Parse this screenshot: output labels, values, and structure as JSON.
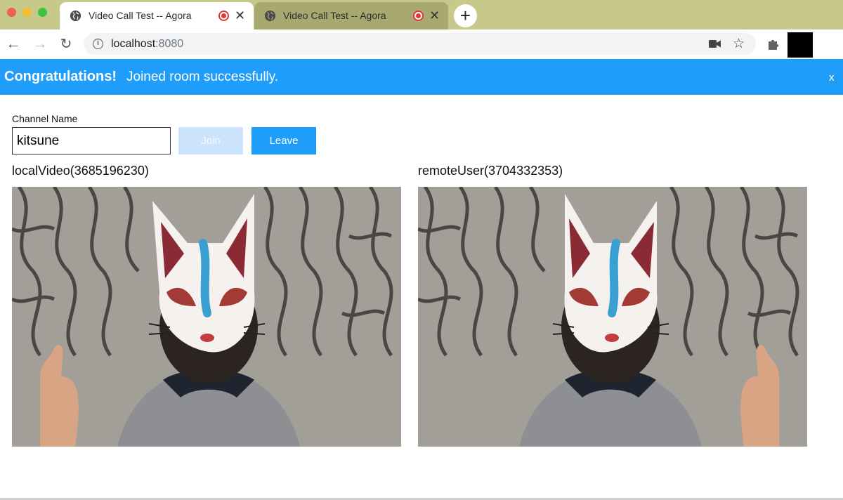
{
  "browser": {
    "tabs": [
      {
        "title": "Video Call Test -- Agora",
        "active": true
      },
      {
        "title": "Video Call Test -- Agora",
        "active": false
      }
    ],
    "address": {
      "host": "localhost",
      "port": ":8080"
    },
    "icons": {
      "back": "arrow-left-icon",
      "forward": "arrow-right-icon",
      "reload": "reload-icon",
      "info": "info-icon",
      "camera": "video-camera-icon",
      "bookmark": "star-icon",
      "extensions": "puzzle-icon",
      "tab_favicon": "globe-icon",
      "recording": "recording-icon",
      "close": "close-icon",
      "new_tab": "plus-icon"
    }
  },
  "banner": {
    "strong": "Congratulations!",
    "message": "Joined room successfully.",
    "close": "x",
    "color": "#1e9dfb"
  },
  "form": {
    "channel_label": "Channel Name",
    "channel_value": "kitsune",
    "join_label": "Join",
    "leave_label": "Leave"
  },
  "videos": {
    "local_label": "localVideo(3685196230)",
    "remote_label": "remoteUser(3704332353)"
  },
  "colors": {
    "accent": "#1e9dfb",
    "disabled": "#cce4fb",
    "tabstrip": "#c7c98a"
  }
}
